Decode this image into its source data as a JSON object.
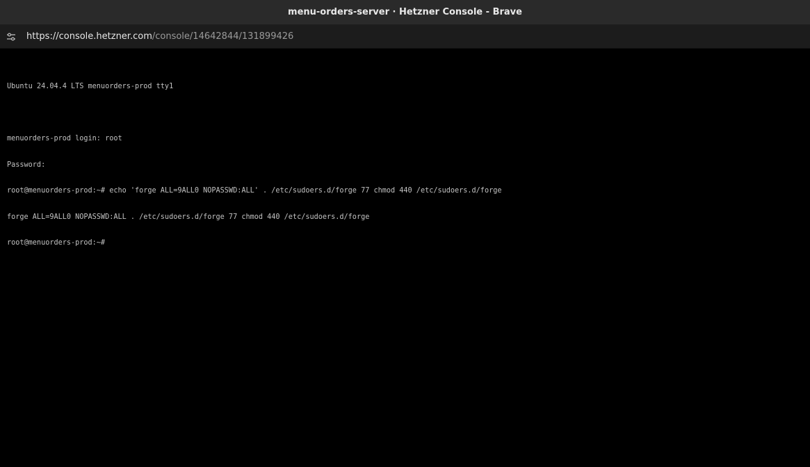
{
  "window": {
    "title": "menu-orders-server · Hetzner Console - Brave"
  },
  "urlbar": {
    "site_settings_icon": "site-settings-icon",
    "url_host": "https://console.hetzner.com",
    "url_path": "/console/14642844/131899426"
  },
  "terminal": {
    "lines": [
      "Ubuntu 24.04.4 LTS menuorders-prod tty1",
      "",
      "menuorders-prod login: root",
      "Password:",
      "root@menuorders-prod:~# echo 'forge ALL=9ALL0 NOPASSWD:ALL' . /etc/sudoers.d/forge 77 chmod 440 /etc/sudoers.d/forge",
      "forge ALL=9ALL0 NOPASSWD:ALL . /etc/sudoers.d/forge 77 chmod 440 /etc/sudoers.d/forge",
      "root@menuorders-prod:~#"
    ]
  }
}
